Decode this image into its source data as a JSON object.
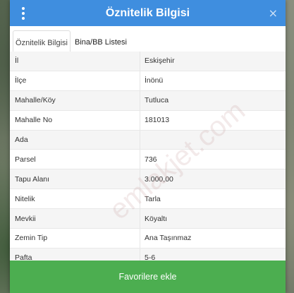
{
  "header": {
    "title": "Öznitelik Bilgisi",
    "close_glyph": "×",
    "menu_icon": "kebab-menu-icon"
  },
  "tabs": [
    {
      "label": "Öznitelik Bilgisi",
      "active": true
    },
    {
      "label": "Bina/BB Listesi",
      "active": false
    }
  ],
  "rows": [
    {
      "label": "İl",
      "value": "Eskişehir"
    },
    {
      "label": "İlçe",
      "value": "İnönü"
    },
    {
      "label": "Mahalle/Köy",
      "value": "Tutluca"
    },
    {
      "label": "Mahalle No",
      "value": "181013"
    },
    {
      "label": "Ada",
      "value": ""
    },
    {
      "label": "Parsel",
      "value": "736"
    },
    {
      "label": "Tapu Alanı",
      "value": "3.000,00"
    },
    {
      "label": "Nitelik",
      "value": "Tarla"
    },
    {
      "label": "Mevkii",
      "value": "Köyaltı"
    },
    {
      "label": "Zemin Tip",
      "value": "Ana Taşınmaz"
    },
    {
      "label": "Pafta",
      "value": "5-6"
    }
  ],
  "watermark": "emlakjet.com",
  "footer": {
    "favorite_label": "Favorilere ekle"
  },
  "colors": {
    "header": "#3f8edf",
    "favorite_button": "#4cae50"
  }
}
